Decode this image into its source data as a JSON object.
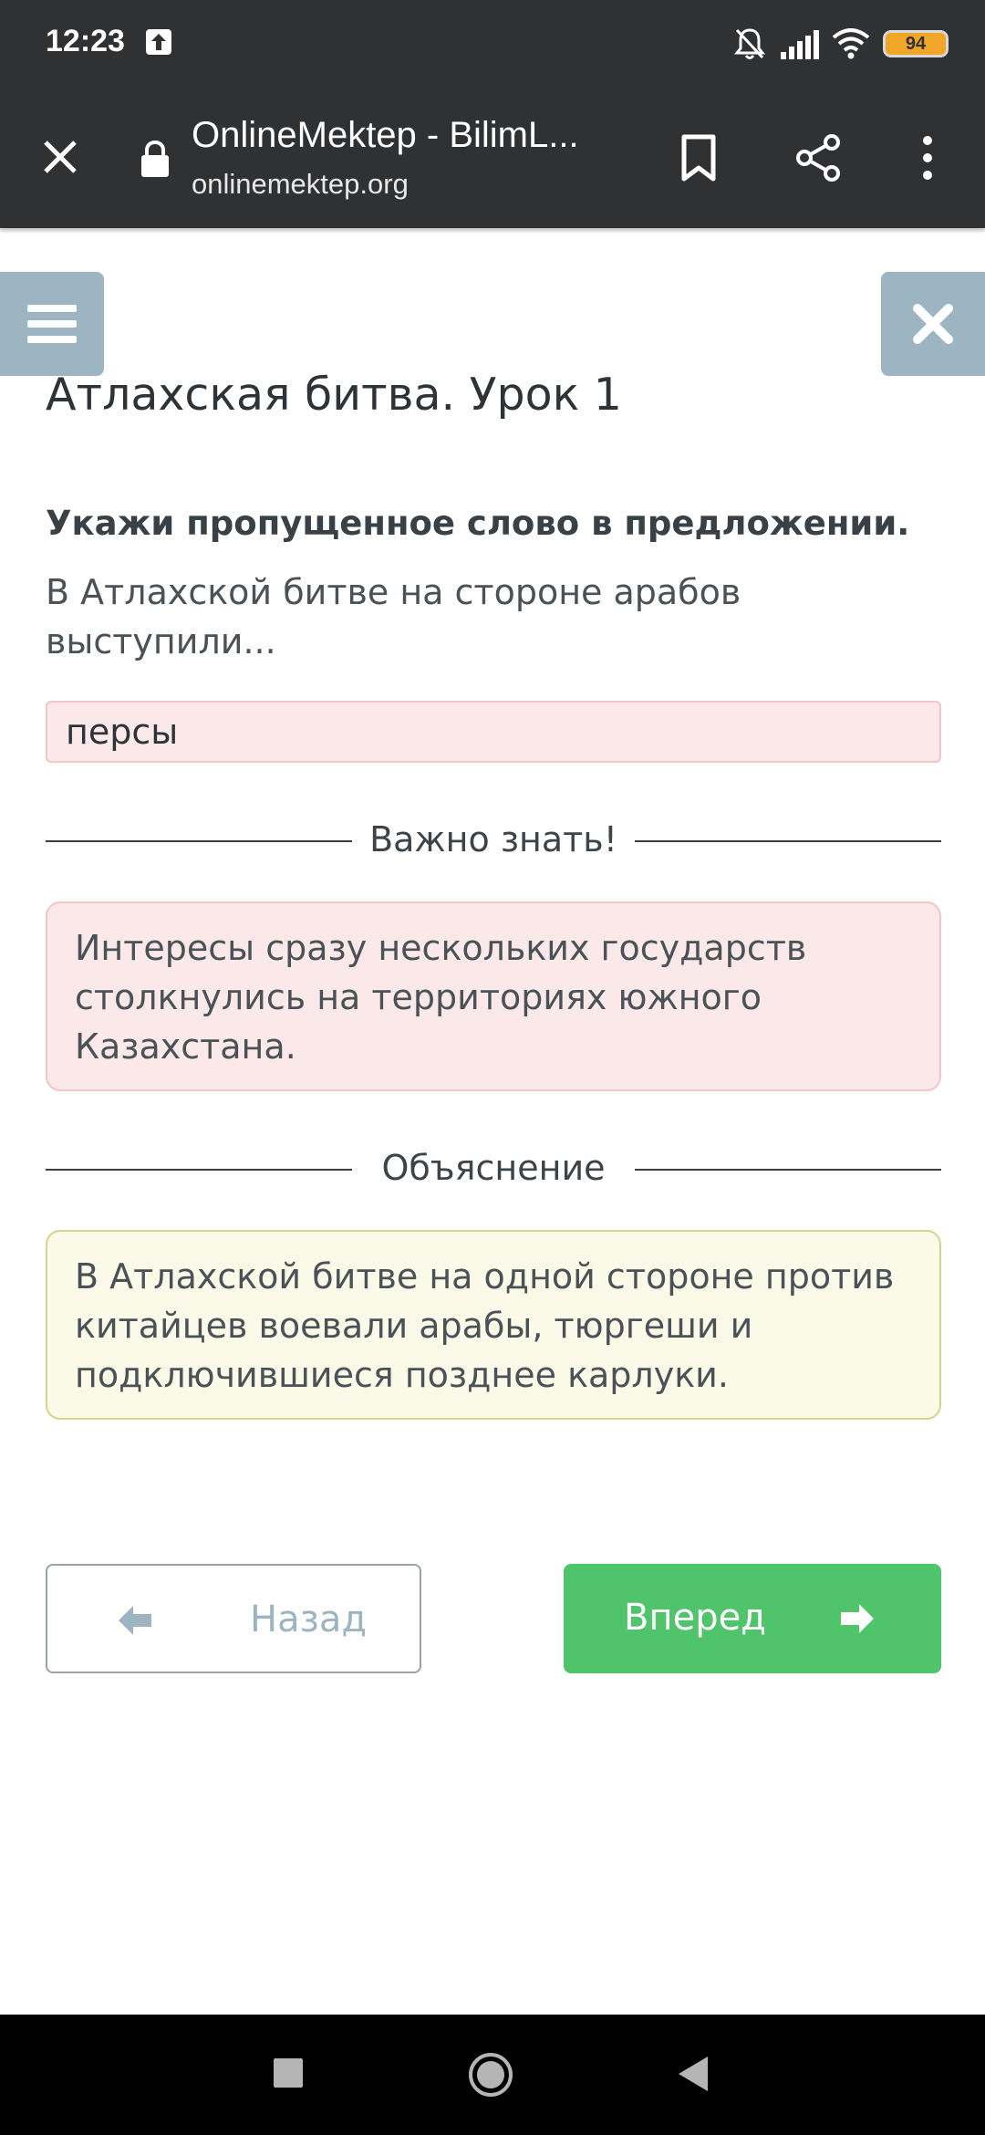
{
  "status_bar": {
    "time": "12:23",
    "battery": "94",
    "icons": [
      "upload-icon",
      "bell-muted-icon",
      "signal-icon",
      "wifi-icon",
      "battery-icon"
    ]
  },
  "browser": {
    "title": "OnlineMektep - BilimL...",
    "url": "onlinemektep.org",
    "icons": [
      "close-icon",
      "lock-icon",
      "bookmark-icon",
      "share-icon",
      "more-vertical-icon"
    ]
  },
  "page": {
    "title": "Атлахская битва. Урок 1"
  },
  "task": {
    "instruction": "Укажи пропущенное слово в предложении.",
    "sentence": "В Атлахской битве на стороне арабов выступили...",
    "answer": "персы"
  },
  "important": {
    "heading": "Важно знать!",
    "text": "Интересы сразу нескольких государств столкнулись на территориях южного Казахстана."
  },
  "explanation": {
    "heading": "Объяснение",
    "text": "В Атлахской битве на одной стороне против китайцев воевали арабы, тюргеши и подключившиеся позднее карлуки."
  },
  "navigation": {
    "back_label": "Назад",
    "forward_label": "Вперед"
  },
  "colors": {
    "toolbar": "#303133",
    "side_buttons": "#9db4c2",
    "answer_bg": "#fbe9ea",
    "explanation_bg": "#fbfae8",
    "forward_button": "#4fc46b"
  }
}
